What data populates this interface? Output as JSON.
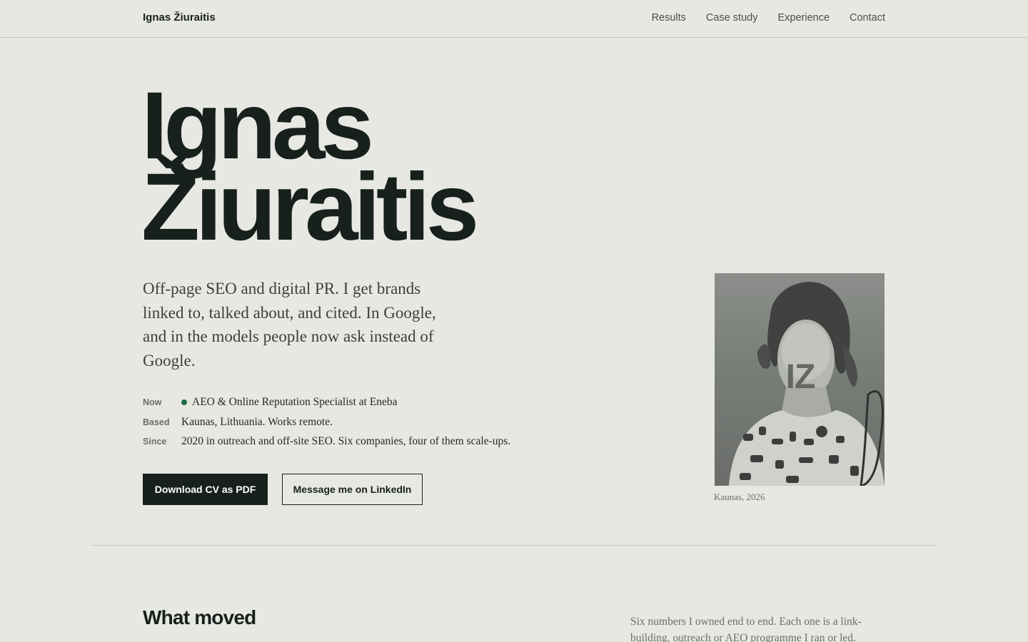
{
  "header": {
    "brand": "Ignas Žiuraitis",
    "nav": [
      "Results",
      "Case study",
      "Experience",
      "Contact"
    ]
  },
  "hero": {
    "name_line1": "Ignas",
    "name_line2": "Žiuraitis",
    "tagline": "Off-page SEO and digital PR. I get brands linked to, talked about, and cited. In Google, and in the models people now ask instead of Google.",
    "facts": [
      {
        "key": "Now",
        "value": "AEO & Online Reputation Specialist at Eneba"
      },
      {
        "key": "Based",
        "value": "Kaunas, Lithuania. Works remote."
      },
      {
        "key": "Since",
        "value": "2020 in outreach and off-site SEO. Six companies, four of them scale-ups."
      }
    ],
    "primary_button": "Download CV as PDF",
    "secondary_button": "Message me on LinkedIn",
    "photo_initials": "IZ",
    "photo_caption": "Kaunas, 2026"
  },
  "results": {
    "title": "What moved",
    "intro": "Six numbers I owned end to end. Each one is a link-building, outreach or AEO programme I ran or led."
  },
  "colors": {
    "background": "#e7e8e2",
    "ink": "#17201c",
    "status_dot": "#1f6b42"
  }
}
